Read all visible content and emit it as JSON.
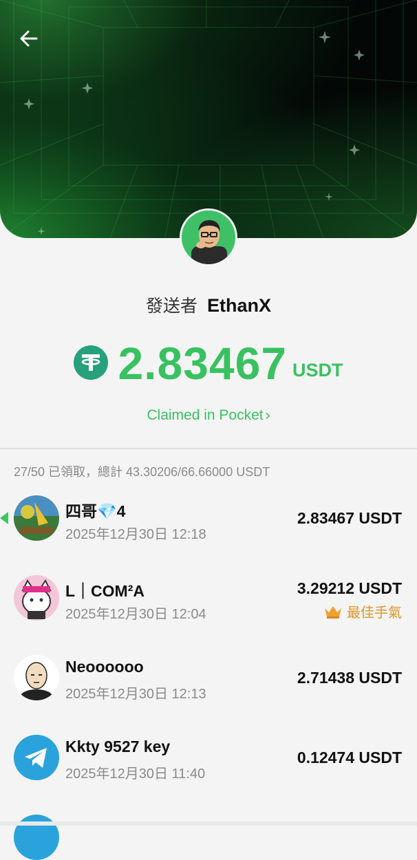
{
  "header": {
    "back_icon": "back-arrow-icon"
  },
  "sender": {
    "label": "發送者",
    "name": "EthanX"
  },
  "amount": {
    "value": "2.83467",
    "unit": "USDT",
    "icon": "tether-icon"
  },
  "claimed_link": {
    "label": "Claimed in Pocket",
    "chevron": "›"
  },
  "summary": "27/50 已領取，總計 43.30206/66.66000 USDT",
  "claims": [
    {
      "name": "四哥💎4",
      "time": "2025年12月30日 12:18",
      "amount": "2.83467 USDT"
    },
    {
      "name": "L｜COM²A",
      "time": "2025年12月30日 12:04",
      "amount": "3.29212 USDT",
      "badge": "最佳手氣"
    },
    {
      "name": "Neoooooo",
      "time": "2025年12月30日 12:13",
      "amount": "2.71438 USDT"
    },
    {
      "name": "Kkty 9527 key",
      "time": "2025年12月30日 11:40",
      "amount": "0.12474 USDT"
    }
  ],
  "colors": {
    "accent": "#39c161",
    "tether": "#26a17b",
    "gold": "#e0962a"
  }
}
